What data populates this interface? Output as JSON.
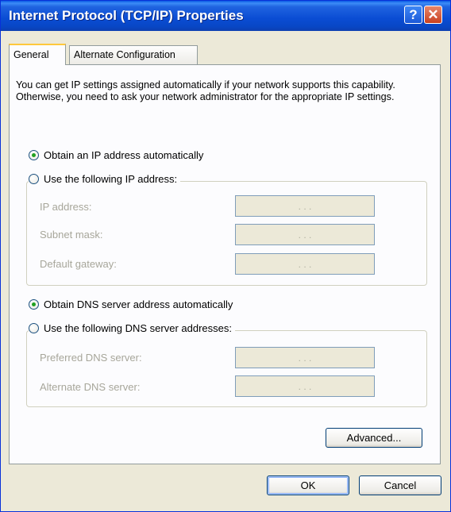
{
  "window": {
    "title": "Internet Protocol (TCP/IP) Properties",
    "help_glyph": "?",
    "close_glyph": "✕"
  },
  "tabs": [
    {
      "label": "General",
      "selected": true
    },
    {
      "label": "Alternate Configuration",
      "selected": false
    }
  ],
  "intro_text": "You can get IP settings assigned automatically if your network supports this capability. Otherwise, you need to ask your network administrator for the appropriate IP settings.",
  "ip": {
    "auto_label": "Obtain an IP address automatically",
    "auto_selected": true,
    "manual_label": "Use the following IP address:",
    "fields": [
      {
        "label": "IP address:",
        "value": ". . ."
      },
      {
        "label": "Subnet mask:",
        "value": ". . ."
      },
      {
        "label": "Default gateway:",
        "value": ". . ."
      }
    ]
  },
  "dns": {
    "auto_label": "Obtain DNS server address automatically",
    "auto_selected": true,
    "manual_label": "Use the following DNS server addresses:",
    "fields": [
      {
        "label": "Preferred DNS server:",
        "value": ". . ."
      },
      {
        "label": "Alternate DNS server:",
        "value": ". . ."
      }
    ]
  },
  "buttons": {
    "advanced": "Advanced...",
    "ok": "OK",
    "cancel": "Cancel"
  }
}
